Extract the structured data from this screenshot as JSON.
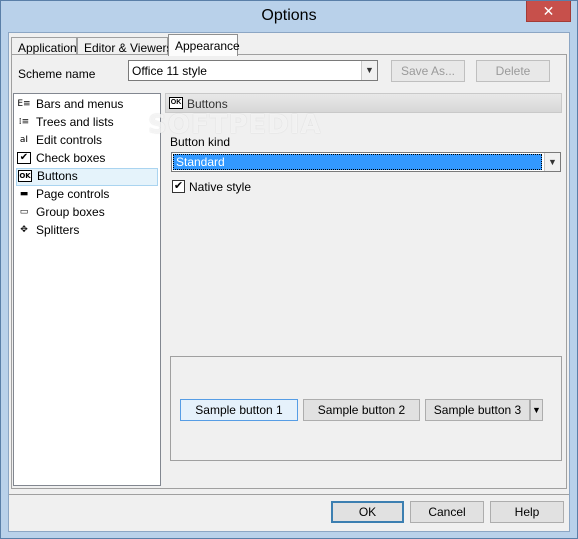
{
  "window": {
    "title": "Options",
    "close_glyph": "✕"
  },
  "tabs": [
    {
      "label": "Application"
    },
    {
      "label": "Editor & Viewers"
    },
    {
      "label": "Appearance",
      "active": true
    }
  ],
  "scheme": {
    "label": "Scheme name",
    "value": "Office 11 style",
    "save_as_label": "Save As...",
    "delete_label": "Delete"
  },
  "tree": {
    "items": [
      {
        "label": "Bars and menus",
        "icon": "menu-bar-icon",
        "glyph": "E≡"
      },
      {
        "label": "Trees and lists",
        "icon": "tree-list-icon",
        "glyph": "⁞≡"
      },
      {
        "label": "Edit controls",
        "icon": "edit-control-icon",
        "glyph": "aI"
      },
      {
        "label": "Check boxes",
        "icon": "checkbox-icon",
        "glyph": "✔"
      },
      {
        "label": "Buttons",
        "icon": "ok-button-icon",
        "glyph": "OK",
        "selected": true
      },
      {
        "label": "Page controls",
        "icon": "page-control-icon",
        "glyph": "▬"
      },
      {
        "label": "Group boxes",
        "icon": "group-box-icon",
        "glyph": "▭"
      },
      {
        "label": "Splitters",
        "icon": "splitter-icon",
        "glyph": "✥"
      }
    ]
  },
  "panel": {
    "header_title": "Buttons",
    "header_icon_glyph": "OK",
    "watermark": "SOFTPEDIA",
    "button_kind_label": "Button kind",
    "button_kind_value": "Standard",
    "native_style_label": "Native style",
    "native_style_checked": true,
    "samples": [
      "Sample button 1",
      "Sample button 2",
      "Sample button 3"
    ]
  },
  "footer": {
    "ok_label": "OK",
    "cancel_label": "Cancel",
    "help_label": "Help"
  },
  "colors": {
    "selection": "#3399ff",
    "titlebar": "#b9d1ea",
    "close": "#c7504b"
  }
}
